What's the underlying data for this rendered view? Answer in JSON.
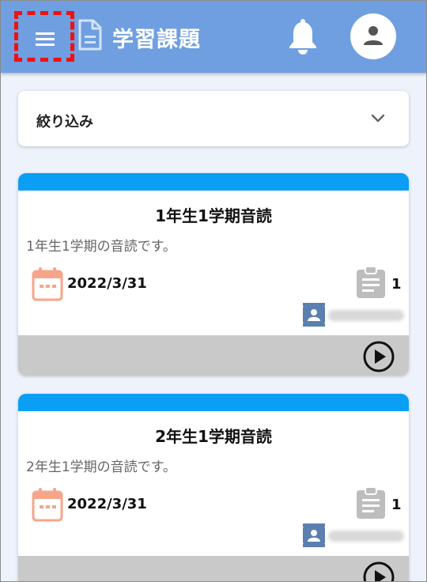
{
  "header": {
    "title": "学習課題",
    "menu_icon": "hamburger-menu-icon",
    "doc_icon": "document-icon",
    "bell_icon": "bell-icon",
    "avatar_icon": "person-icon",
    "bg_color": "#6f9fe0",
    "highlight_color": "#f01010"
  },
  "filter": {
    "label": "絞り込み",
    "icon": "chevron-down-icon"
  },
  "cards": [
    {
      "title": "1年生1学期音読",
      "description": "1年生1学期の音読です。",
      "due_date": "2022/3/31",
      "count": "1",
      "accent_color": "#0a9ef5"
    },
    {
      "title": "2年生1学期音読",
      "description": "2年生1学期の音読です。",
      "due_date": "2022/3/31",
      "count": "1",
      "accent_color": "#0a9ef5"
    }
  ],
  "colors": {
    "calendar": "#f7a58a",
    "clipboard": "#bdbdbd",
    "badge": "#5b7fae",
    "footer": "#c9c9c9"
  }
}
